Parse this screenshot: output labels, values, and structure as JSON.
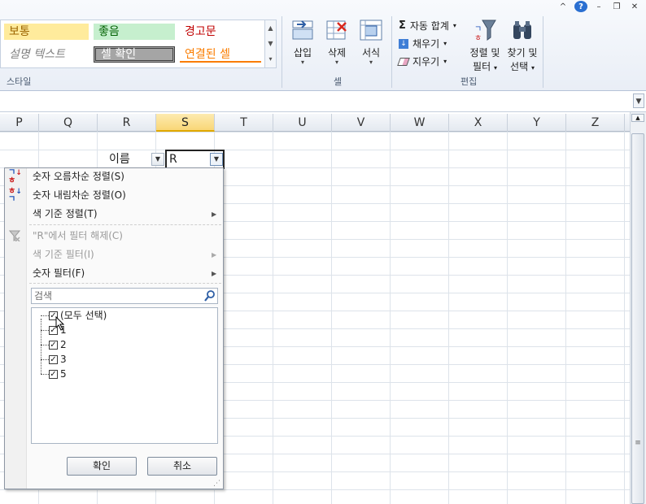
{
  "window_controls": {
    "caret": "^",
    "help": "?",
    "minimize": "–",
    "restore": "❐",
    "close": "✕"
  },
  "ribbon": {
    "styles": {
      "bad": {
        "label": "보통",
        "bg": "#ffeb9c",
        "fg": "#9c6500"
      },
      "good": {
        "label": "좋음",
        "bg": "#c6efce",
        "fg": "#006100"
      },
      "warning": {
        "label": "경고문",
        "fg": "#c00000"
      },
      "explanatory": {
        "label": "설명 텍스트",
        "fg": "#7f7f7f"
      },
      "check": {
        "label": "셀 확인",
        "bg": "#a5a5a5",
        "fg": "#ffffff"
      },
      "linked": {
        "label": "연결된 셀",
        "fg": "#fa7d00"
      },
      "group_label": "스타일"
    },
    "cells": {
      "insert": "삽입",
      "delete": "삭제",
      "format": "서식",
      "group_label": "셀"
    },
    "editing": {
      "autosum": "자동 합계",
      "fill": "채우기",
      "clear": "지우기",
      "sort_filter_line1": "정렬 및",
      "sort_filter_line2": "필터",
      "find_select_line1": "찾기 및",
      "find_select_line2": "선택",
      "group_label": "편집"
    }
  },
  "columns": [
    "P",
    "Q",
    "R",
    "S",
    "T",
    "U",
    "V",
    "W",
    "X",
    "Y",
    "Z"
  ],
  "selected_column": "S",
  "cells": {
    "r_header": "이름",
    "s_header": "R"
  },
  "filter_menu": {
    "sort_asc": "숫자 오름차순 정렬(S)",
    "sort_desc": "숫자 내림차순 정렬(O)",
    "sort_by_color": "색 기준 정렬(T)",
    "clear_filter": "\"R\"에서 필터 해제(C)",
    "filter_by_color": "색 기준 필터(I)",
    "number_filter": "숫자 필터(F)",
    "search_placeholder": "검색",
    "items": [
      "(모두 선택)",
      "1",
      "2",
      "3",
      "5"
    ],
    "ok": "확인",
    "cancel": "취소"
  }
}
